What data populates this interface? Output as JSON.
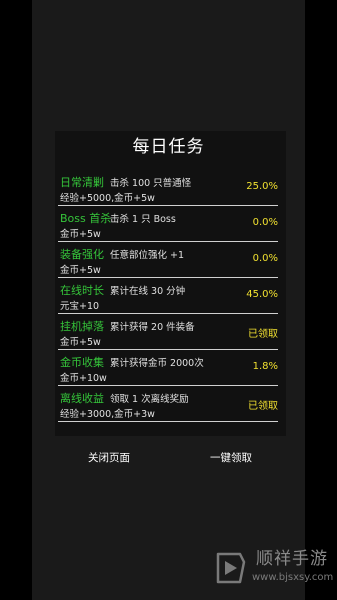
{
  "dialog": {
    "title": "每日任务",
    "tasks": [
      {
        "name": "日常清剿",
        "desc": "击杀 100 只普通怪",
        "reward": "经验+5000,金币+5w",
        "status": "25.0%"
      },
      {
        "name": "Boss 首杀",
        "desc": "击杀 1 只 Boss",
        "reward": "金币+5w",
        "status": "0.0%"
      },
      {
        "name": "装备强化",
        "desc": "任意部位强化 +1",
        "reward": "金币+5w",
        "status": "0.0%"
      },
      {
        "name": "在线时长",
        "desc": "累计在线 30 分钟",
        "reward": "元宝+10",
        "status": "45.0%"
      },
      {
        "name": "挂机掉落",
        "desc": "累计获得 20 件装备",
        "reward": "金币+5w",
        "status": "已领取"
      },
      {
        "name": "金币收集",
        "desc": "累计获得金币 2000次",
        "reward": "金币+10w",
        "status": "1.8%"
      },
      {
        "name": "离线收益",
        "desc": "领取 1 次离线奖励",
        "reward": "经验+3000,金币+3w",
        "status": "已领取"
      }
    ],
    "close_label": "关闭页面",
    "claim_all_label": "一键领取"
  },
  "watermark": {
    "name": "顺祥手游",
    "url": "www.bjsxsy.com"
  },
  "colors": {
    "task_name": "#35c43a",
    "status": "#f0e030",
    "panel": "#111111",
    "background": "#1a1a1a"
  }
}
